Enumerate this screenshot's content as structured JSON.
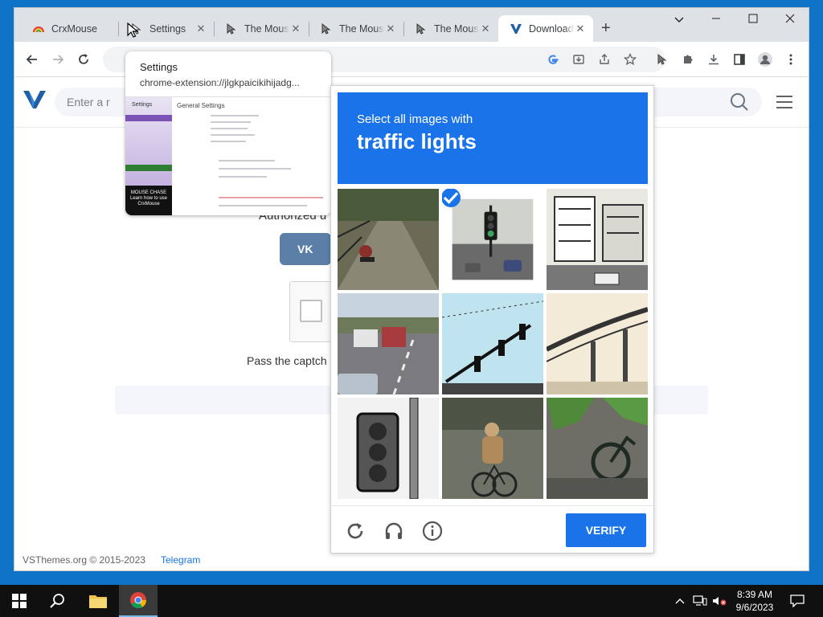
{
  "browser": {
    "tabs": [
      {
        "title": "CrxMouse",
        "icon": "rainbow-icon"
      },
      {
        "title": "Settings",
        "icon": "cursor-icon"
      },
      {
        "title": "The Mouse",
        "icon": "cursor-icon"
      },
      {
        "title": "The Mouse",
        "icon": "cursor-icon"
      },
      {
        "title": "The Mouse",
        "icon": "cursor-icon"
      },
      {
        "title": "Download",
        "icon": "vsthemes-icon"
      }
    ],
    "hover_card": {
      "title": "Settings",
      "url": "chrome-extension://jlgkpaicikihijadg...",
      "preview": {
        "settings_label": "Settings",
        "general_settings": "General Settings",
        "mouse_chase": "MOUSE CHASE",
        "learn_how": "Learn how to use CrxMouse"
      }
    }
  },
  "site": {
    "search_placeholder": "Enter a r",
    "heading_fragment": "u",
    "authorized": "Authorized u",
    "vk_label": "VK",
    "pass_captcha": "Pass the captch",
    "footer_copyright": "VSThemes.org © 2015-2023",
    "footer_link": "Telegram"
  },
  "captcha": {
    "instruction": "Select all images with",
    "target": "traffic lights",
    "tiles": [
      {
        "name": "tile-1",
        "selected": false
      },
      {
        "name": "tile-2",
        "selected": true
      },
      {
        "name": "tile-3",
        "selected": false
      },
      {
        "name": "tile-4",
        "selected": false
      },
      {
        "name": "tile-5",
        "selected": false
      },
      {
        "name": "tile-6",
        "selected": false
      },
      {
        "name": "tile-7",
        "selected": false
      },
      {
        "name": "tile-8",
        "selected": false
      },
      {
        "name": "tile-9",
        "selected": false
      }
    ],
    "verify_label": "VERIFY"
  },
  "taskbar": {
    "time": "8:39 AM",
    "date": "9/6/2023"
  },
  "colors": {
    "accent": "#1a73e8",
    "desktop": "#0f74c8",
    "taskbar": "#101010"
  }
}
